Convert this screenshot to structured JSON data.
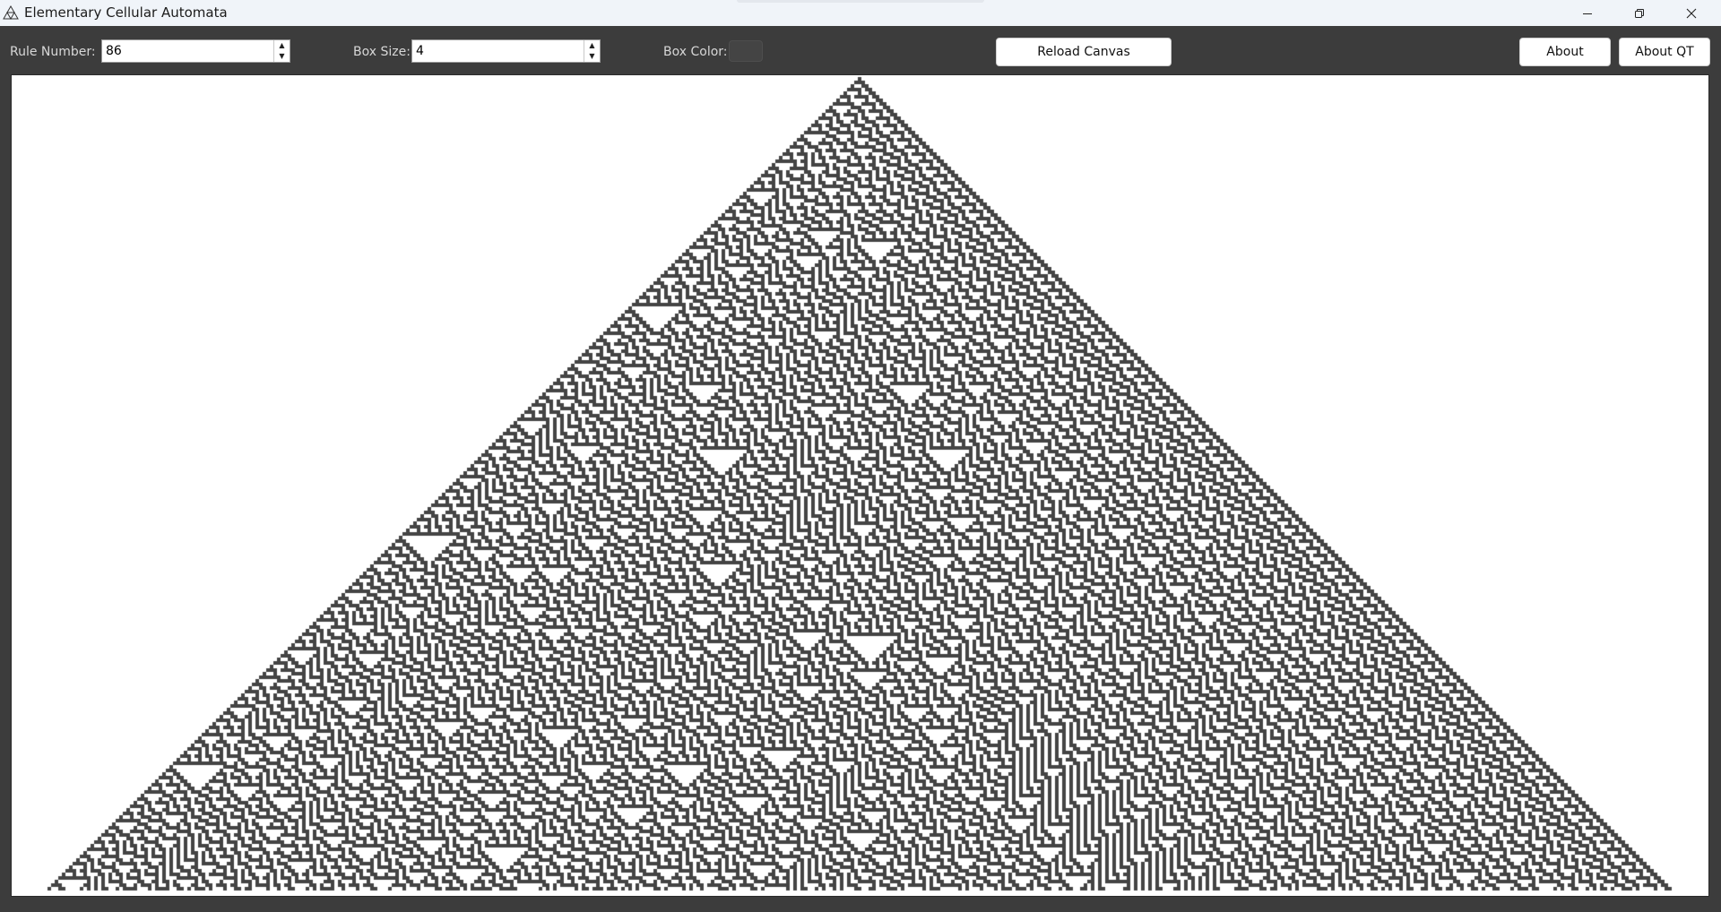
{
  "window": {
    "title": "Elementary Cellular Automata",
    "controls": [
      "minimize-icon",
      "restore-icon",
      "close-icon"
    ]
  },
  "toolbar": {
    "rule_label": "Rule Number:",
    "rule_value": "86",
    "box_size_label": "Box Size:",
    "box_size_value": "4",
    "box_color_label": "Box Color:",
    "box_color": "#444444",
    "reload_label": "Reload Canvas",
    "about_label": "About",
    "about_qt_label": "About QT"
  },
  "canvas": {
    "rule": 86,
    "cell_size": 4,
    "cell_color": "#444444",
    "background": "#ffffff"
  }
}
